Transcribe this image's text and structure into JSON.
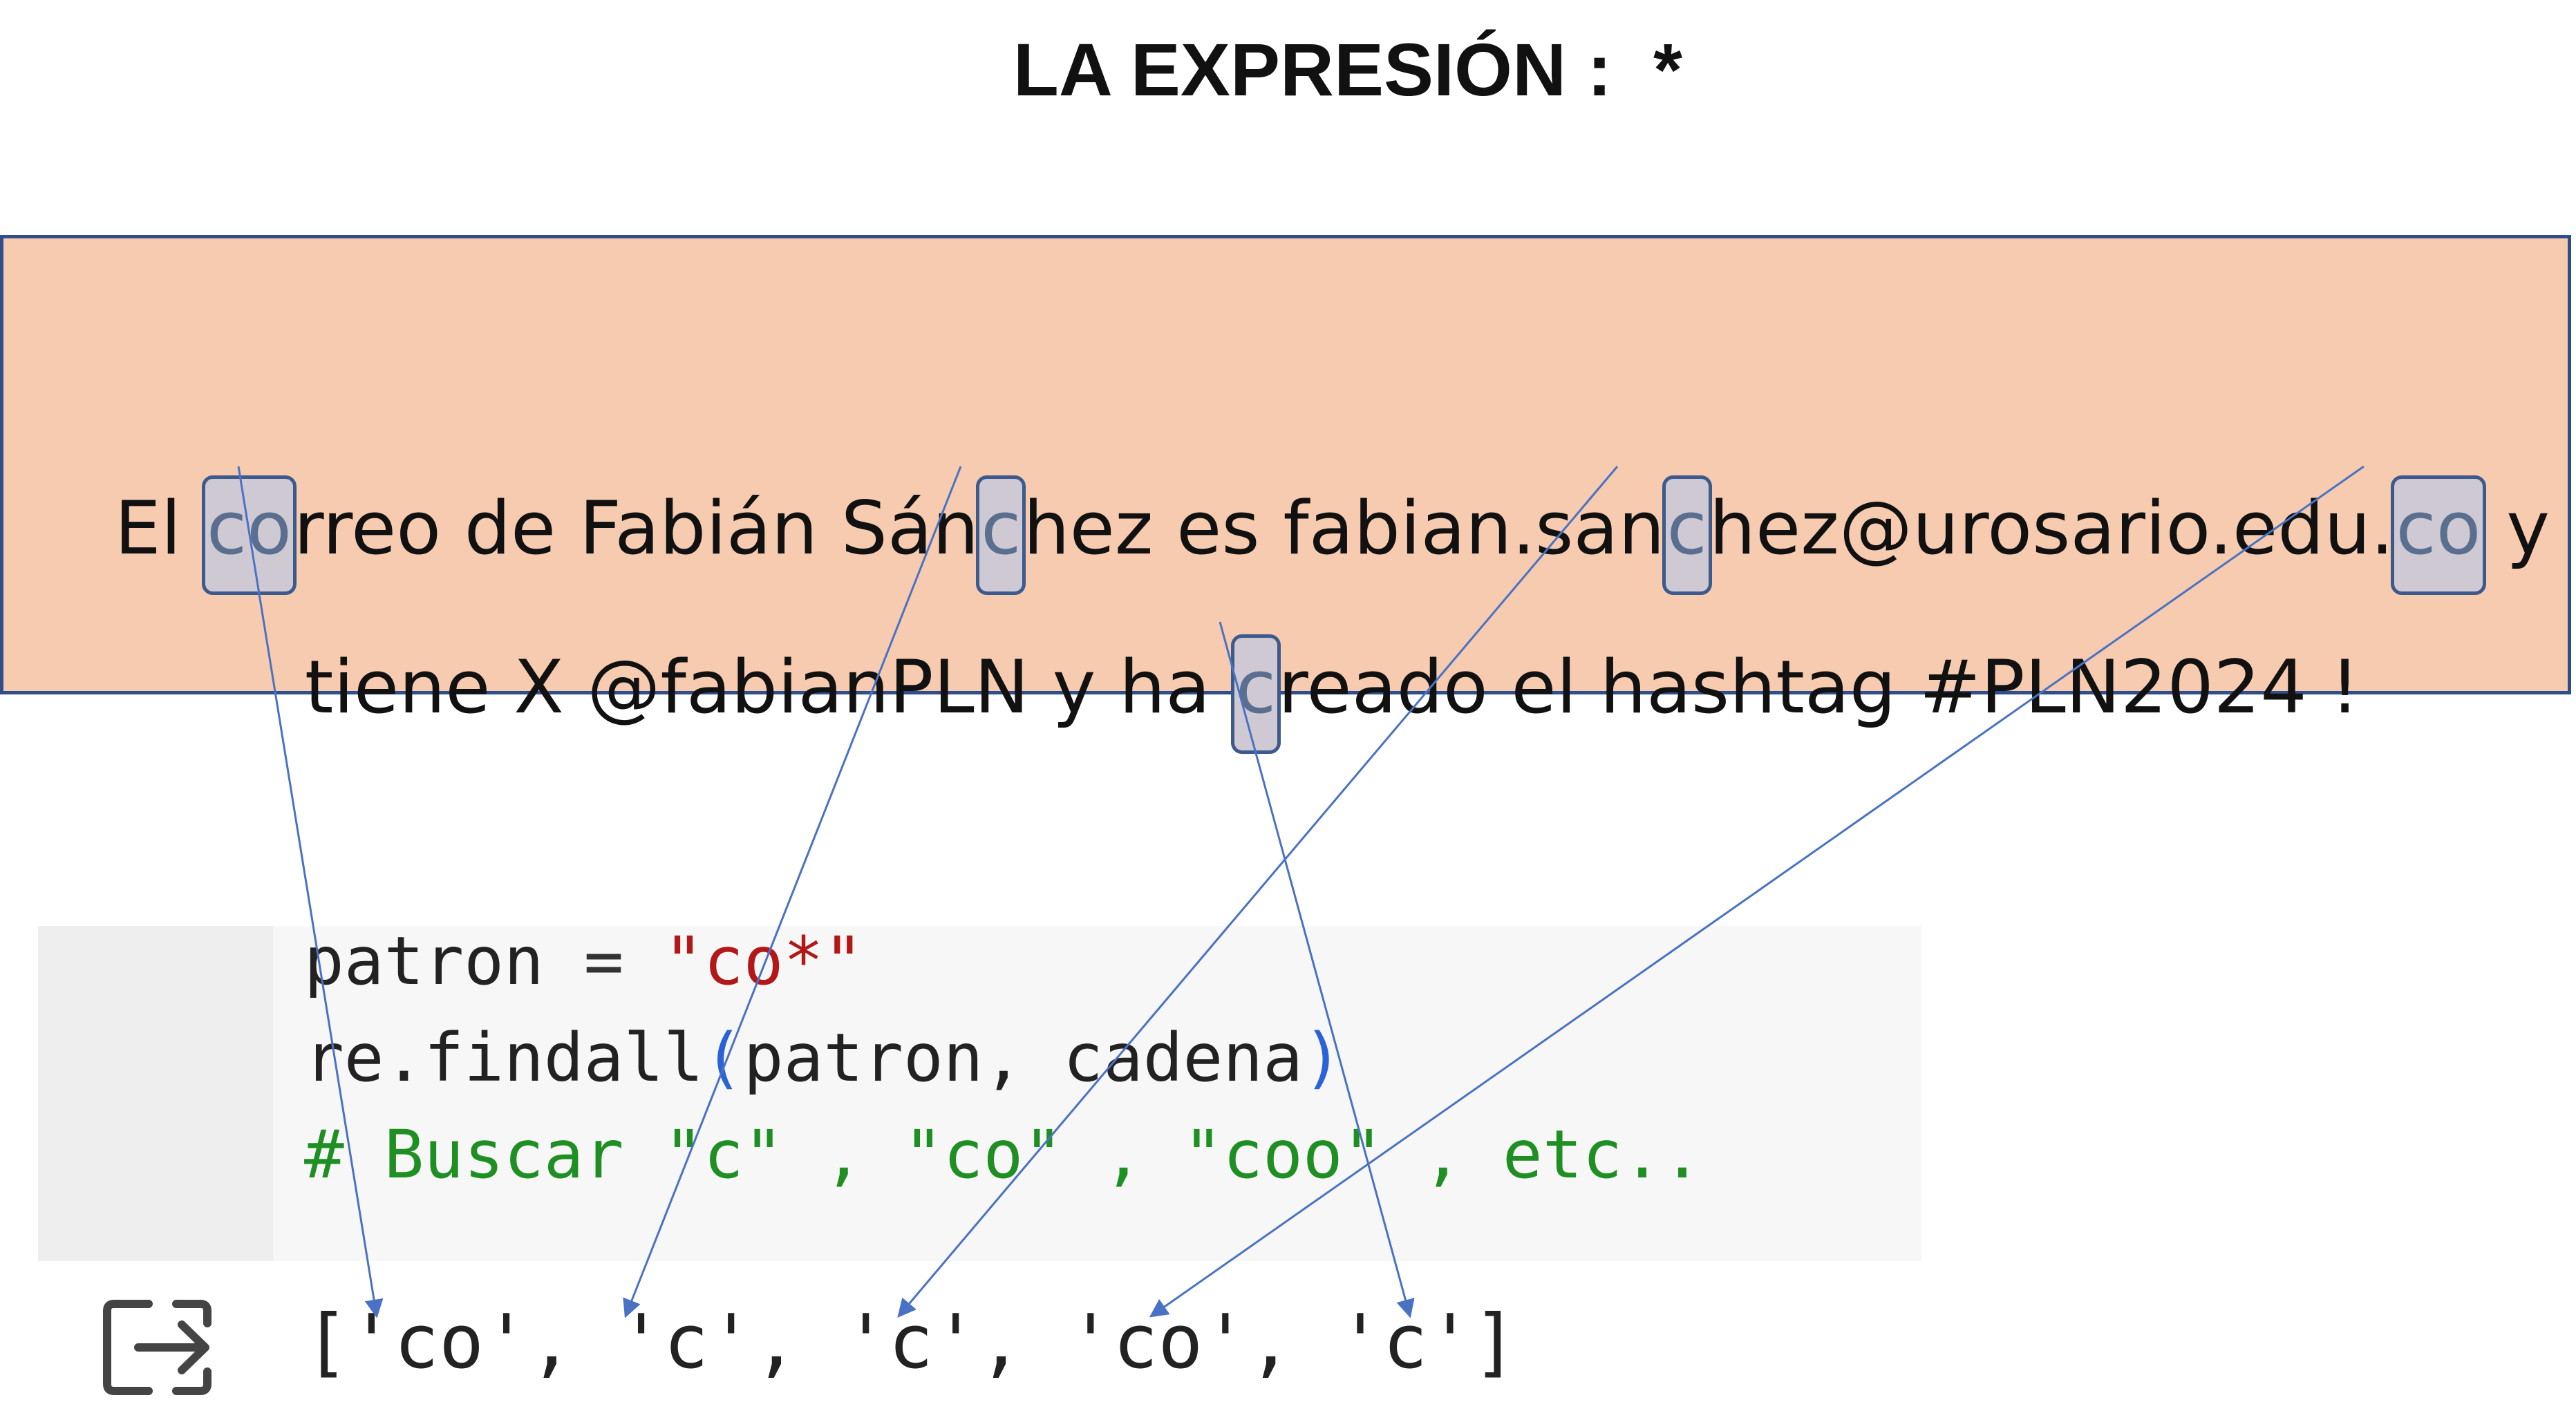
{
  "title": "LA EXPRESIÓN :  *",
  "sentence": {
    "line1": [
      {
        "text": "El ",
        "hl": false
      },
      {
        "text": "co",
        "hl": true
      },
      {
        "text": "rreo de Fabián Sán",
        "hl": false
      },
      {
        "text": "c",
        "hl": true
      },
      {
        "text": "hez es fabian.san",
        "hl": false
      },
      {
        "text": "c",
        "hl": true
      },
      {
        "text": "hez@urosario.edu.",
        "hl": false
      },
      {
        "text": "co",
        "hl": true
      },
      {
        "text": " y",
        "hl": false
      }
    ],
    "line2": [
      {
        "text": "tiene X @fabianPLN y ha ",
        "hl": false
      },
      {
        "text": "c",
        "hl": true
      },
      {
        "text": "reado el hashtag #PLN2024 !",
        "hl": false
      }
    ]
  },
  "code": {
    "line1": {
      "var": "patron",
      "op": " = ",
      "str": "\"co*\""
    },
    "line2": {
      "fn": "re.findall",
      "open": "(",
      "args": "patron, cadena",
      "close": ")"
    },
    "line3": {
      "comment": "# Buscar \"c\" , \"co\" , \"coo\" , etc.."
    }
  },
  "output": {
    "icon": "output-arrow-icon",
    "text": "['co', 'c', 'c', 'co', 'c']"
  },
  "colors": {
    "box_fill": "#f6cbaf",
    "box_border": "#2f4e8c",
    "highlight_fill": "#cfc9d3",
    "arrow": "#4a72c4",
    "string": "#b21818",
    "comment": "#1f8f24",
    "paren": "#2a62d8"
  }
}
